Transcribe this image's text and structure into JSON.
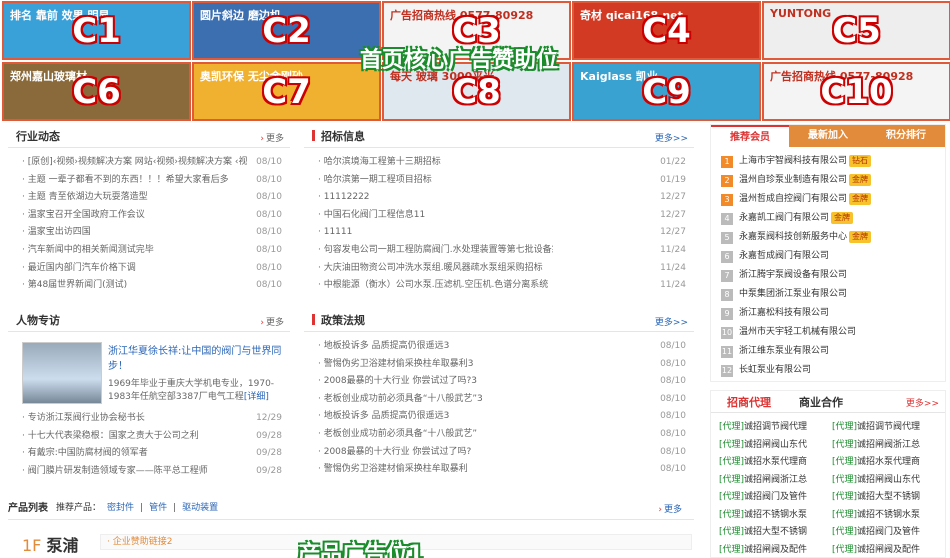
{
  "ads": {
    "center_label": "首页核心广告赞助位",
    "items": [
      {
        "code": "C1",
        "sub": "排名 靠前 效果 明显",
        "bg": "#3aa0d8"
      },
      {
        "code": "C2",
        "sub": "圆片斜边 磨边机",
        "bg": "#3b6fb0"
      },
      {
        "code": "C3",
        "sub": "广告招商热线 0577-80928",
        "bg": "#f4f4f4"
      },
      {
        "code": "C4",
        "sub": "奇材 qicai168.net",
        "bg": "#d23a24"
      },
      {
        "code": "C5",
        "sub": "YUNTONG",
        "bg": "#eeeeee"
      },
      {
        "code": "C6",
        "sub": "郑州嘉山玻璃材",
        "bg": "#8a6a3a"
      },
      {
        "code": "C7",
        "sub": "奥凯环保 无尘金刚砂",
        "bg": "#f0b030"
      },
      {
        "code": "C8",
        "sub": "每天 玻璃 3000平米",
        "bg": "#dfe8ef"
      },
      {
        "code": "C9",
        "sub": "Kaiglass 凯业",
        "bg": "#3aa2d0"
      },
      {
        "code": "C10",
        "sub": "广告招商热线 0577-80928",
        "bg": "#f4f4f4"
      }
    ]
  },
  "industry": {
    "title": "行业动态",
    "more": "更多",
    "items": [
      {
        "t": "[原创]‹视频›视频解决方案 网站‹视频›视频解决方案 ‹视",
        "d": "08/10"
      },
      {
        "t": "主题 一辈子都看不到的东西！！！希望大家看后多",
        "d": "08/10"
      },
      {
        "t": "主题 青至依湖边大玩耍落造型",
        "d": "08/10"
      },
      {
        "t": "温家宝召开全国政府工作会议",
        "d": "08/10"
      },
      {
        "t": "温家宝出访四国",
        "d": "08/10"
      },
      {
        "t": "汽车新闻中的相关新闻测试完毕",
        "d": "08/10"
      },
      {
        "t": "最近国内部门汽车价格下调",
        "d": "08/10"
      },
      {
        "t": "第48届世界新闻门(测试)",
        "d": "08/10"
      }
    ]
  },
  "bids": {
    "title": "招标信息",
    "more": "更多>>",
    "items": [
      {
        "t": "哈尔滨境海工程第十三期招标",
        "d": "01/22"
      },
      {
        "t": "哈尔滨第一期工程项目招标",
        "d": "01/19"
      },
      {
        "t": "11112222",
        "d": "12/27"
      },
      {
        "t": "中国石化阀门工程信息11",
        "d": "12/27"
      },
      {
        "t": "11111",
        "d": "12/27"
      },
      {
        "t": "句容发电公司一期工程防腐阀门.水处理装置等第七批设备筹",
        "d": "11/24"
      },
      {
        "t": "大庆油田物资公司冲洗水泵组.暖风器疏水泵组采购招标",
        "d": "11/24"
      },
      {
        "t": "中根能源（衡水）公司水泵.压滤机.空压机.色谱分离系统",
        "d": "11/24"
      }
    ]
  },
  "people": {
    "title": "人物专访",
    "more": "更多",
    "headline": "浙江华夏徐长祥:让中国的阀门与世界同步！",
    "desc": "1969年毕业于重庆大学机电专业，1970-1983年任航空部3387厂电气工程",
    "detail": "[详细]",
    "items": [
      {
        "t": "专访浙江泵阀行业协会秘书长",
        "d": "12/29"
      },
      {
        "t": "十七大代表梁稳根：国家之责大于公司之利",
        "d": "09/28"
      },
      {
        "t": "有戴宗:中国防腐材阀的领军者",
        "d": "09/28"
      },
      {
        "t": "阀门膜片研发制造领域专家——陈平总工程师",
        "d": "09/28"
      }
    ]
  },
  "policy": {
    "title": "政策法规",
    "more": "更多>>",
    "items": [
      {
        "t": "地板投诉多  品质提高仍很遥远3",
        "d": "08/10"
      },
      {
        "t": "警惕伪劣卫浴建材偷采换柱牟取暴利3",
        "d": "08/10"
      },
      {
        "t": "2008最暴的十大行业  你尝试过了吗?3",
        "d": "08/10"
      },
      {
        "t": "老板创业成功前必须具备“十八般武艺”3",
        "d": "08/10"
      },
      {
        "t": "地板投诉多  品质提高仍很遥远3",
        "d": "08/10"
      },
      {
        "t": "老板创业成功前必须具备“十八般武艺”",
        "d": "08/10"
      },
      {
        "t": "2008最暴的十大行业  你尝试过了吗?",
        "d": "08/10"
      },
      {
        "t": "警惕伪劣卫浴建材偷采换柱牟取暴利",
        "d": "08/10"
      }
    ]
  },
  "members": {
    "tabs": [
      "推荐会员",
      "最新加入",
      "积分排行"
    ],
    "items": [
      {
        "n": "1",
        "name": "上海市宇智阀科技有限公司",
        "badge": "钻石"
      },
      {
        "n": "2",
        "name": "温州自珍泵业制造有限公司",
        "badge": "金牌"
      },
      {
        "n": "3",
        "name": "温州哲成自控阀门有限公司",
        "badge": "金牌"
      },
      {
        "n": "4",
        "name": "永嘉凯工阀门有限公司",
        "badge": "金牌"
      },
      {
        "n": "5",
        "name": "永嘉泵阀科技创新服务中心",
        "badge": "金牌"
      },
      {
        "n": "6",
        "name": "永嘉哲成阀门有限公司",
        "badge": ""
      },
      {
        "n": "7",
        "name": "浙江腾宇泵阀设备有限公司",
        "badge": ""
      },
      {
        "n": "8",
        "name": "中泵集团浙江泵业有限公司",
        "badge": ""
      },
      {
        "n": "9",
        "name": "浙江嘉松科技有限公司",
        "badge": ""
      },
      {
        "n": "10",
        "name": "温州市天宇轻工机械有限公司",
        "badge": ""
      },
      {
        "n": "11",
        "name": "浙江维东泵业有限公司",
        "badge": ""
      },
      {
        "n": "12",
        "name": "长虹泵业有限公司",
        "badge": ""
      }
    ]
  },
  "agents": {
    "tabs": [
      "招商代理",
      "商业合作"
    ],
    "more": "更多>>",
    "items": [
      {
        "tag": "[代理]",
        "t": "诚招调节阀代理"
      },
      {
        "tag": "[代理]",
        "t": "诚招调节阀代理"
      },
      {
        "tag": "[代理]",
        "t": "诚招闸阀山东代"
      },
      {
        "tag": "[代理]",
        "t": "诚招闸阀浙江总"
      },
      {
        "tag": "[代理]",
        "t": "诚招水泵代理商"
      },
      {
        "tag": "[代理]",
        "t": "诚招水泵代理商"
      },
      {
        "tag": "[代理]",
        "t": "诚招闸阀浙江总"
      },
      {
        "tag": "[代理]",
        "t": "诚招闸阀山东代"
      },
      {
        "tag": "[代理]",
        "t": "诚招阀门及管件"
      },
      {
        "tag": "[代理]",
        "t": "诚招大型不锈钢"
      },
      {
        "tag": "[代理]",
        "t": "诚招不锈钢水泵"
      },
      {
        "tag": "[代理]",
        "t": "诚招不锈钢水泵"
      },
      {
        "tag": "[代理]",
        "t": "诚招大型不锈钢"
      },
      {
        "tag": "[代理]",
        "t": "诚招阀门及管件"
      },
      {
        "tag": "[代理]",
        "t": "诚招闸阀及配件"
      },
      {
        "tag": "[代理]",
        "t": "诚招闸阀及配件"
      }
    ]
  },
  "products": {
    "title": "产品列表",
    "rec": "推荐产品：",
    "links": [
      "密封件",
      "管件",
      "驱动装置"
    ],
    "more": "更多",
    "floor": "1F",
    "floor_name": "泵浦",
    "sponsor": "· 企业赞助链接2",
    "ad_label": "产品广告位1"
  }
}
